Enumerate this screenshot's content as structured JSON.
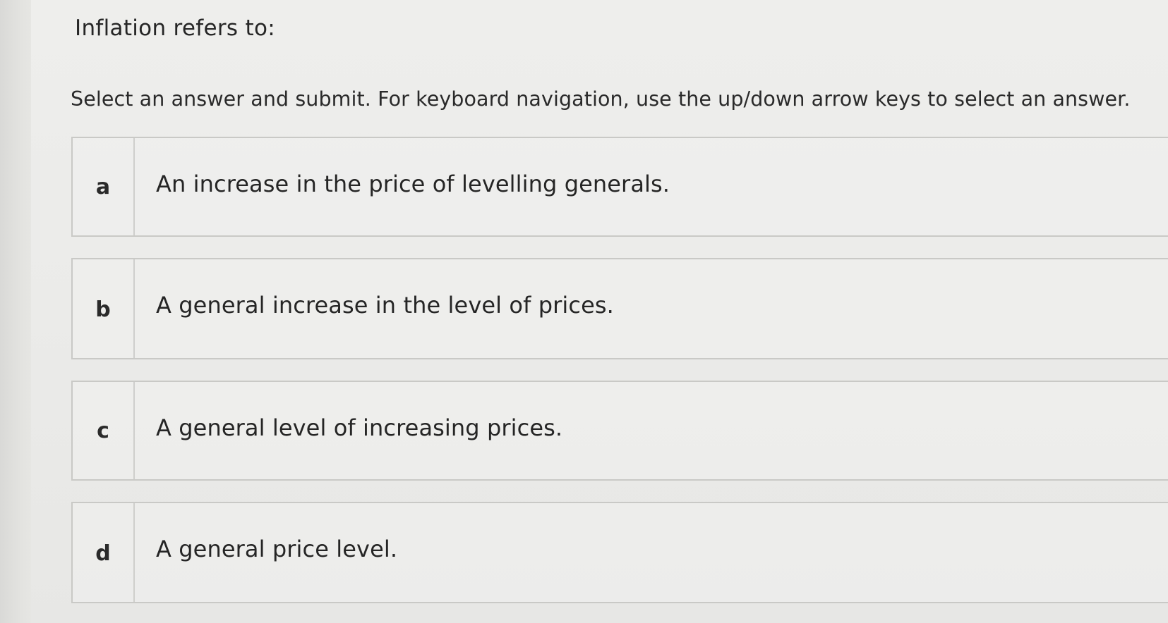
{
  "question": {
    "title": "Inflation refers to:",
    "instructions": "Select an answer and submit. For keyboard navigation, use the up/down arrow keys to select an answer."
  },
  "choices": [
    {
      "letter": "a",
      "text": "An increase in the price of levelling generals."
    },
    {
      "letter": "b",
      "text": "A general increase in the level of prices."
    },
    {
      "letter": "c",
      "text": "A general level of increasing prices."
    },
    {
      "letter": "d",
      "text": "A general price level."
    }
  ],
  "colors": {
    "background": "#ebebe9",
    "border": "#c9c9c6",
    "text": "#262626"
  }
}
